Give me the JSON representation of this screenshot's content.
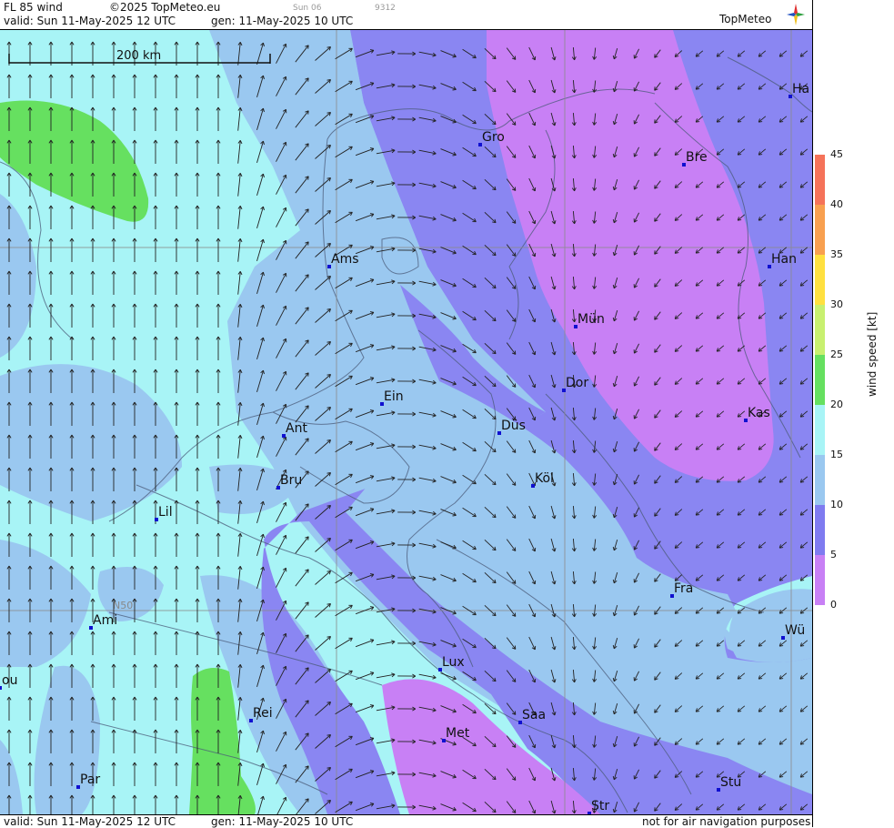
{
  "header": {
    "title": "FL 85 wind",
    "copyright": "©2025 TopMeteo.eu",
    "valid": "valid:  Sun  11-May-2025  12 UTC",
    "generated": "gen: 11-May-2025 10 UTC",
    "run": "Sun 06",
    "code": "9312",
    "logo": "TopMeteo"
  },
  "footer": {
    "valid": "valid:  Sun  11-May-2025  12 UTC",
    "generated": "gen: 11-May-2025 10 UTC",
    "disclaimer": "not for air navigation purposes"
  },
  "scale_bar": {
    "label": "200 km"
  },
  "grid_label": "N50",
  "colorbar": {
    "title": "wind  speed  [kt]",
    "ticks": [
      "45",
      "40",
      "35",
      "30",
      "25",
      "20",
      "15",
      "10",
      "5",
      "0"
    ],
    "colors": [
      "#f5735a",
      "#f8a050",
      "#ffe040",
      "#c8f070",
      "#66e060",
      "#a8f4f6",
      "#9ac8f0",
      "#7f7bf0",
      "#c880f5"
    ]
  },
  "cities": [
    {
      "name": "Gro"
    },
    {
      "name": "Bre"
    },
    {
      "name": "Ha"
    },
    {
      "name": "Ams"
    },
    {
      "name": "Han"
    },
    {
      "name": "Mün"
    },
    {
      "name": "Ein"
    },
    {
      "name": "Dor"
    },
    {
      "name": "Kas"
    },
    {
      "name": "Ant"
    },
    {
      "name": "Düs"
    },
    {
      "name": "Bru"
    },
    {
      "name": "Köl"
    },
    {
      "name": "Lil"
    },
    {
      "name": "Fra"
    },
    {
      "name": "Ami"
    },
    {
      "name": "Wü"
    },
    {
      "name": "Lux"
    },
    {
      "name": "ou"
    },
    {
      "name": "Rei"
    },
    {
      "name": "Saa"
    },
    {
      "name": "Met"
    },
    {
      "name": "Par"
    },
    {
      "name": "Stu"
    },
    {
      "name": "Str"
    }
  ]
}
